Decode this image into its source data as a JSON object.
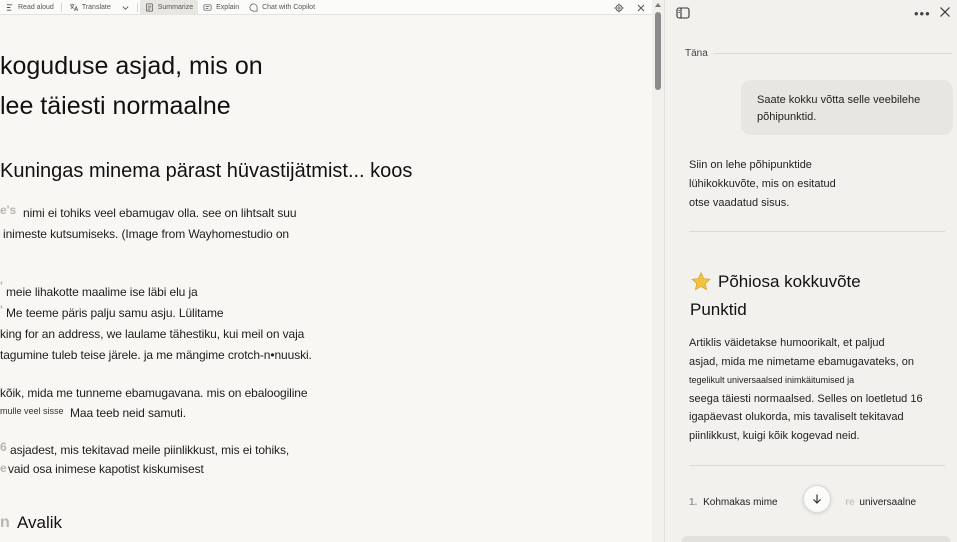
{
  "toolbar": {
    "read_aloud": "Read aloud",
    "translate": "Translate",
    "summarize": "Summarize",
    "explain": "Explain",
    "chat": "Chat with Copilot"
  },
  "article": {
    "heading1_line1": "koguduse asjad, mis on",
    "heading1_line2": "lee täiesti normaalne",
    "heading2": "Kuningas minema pärast hüvastijätmist... koos",
    "para1_frag": "e's",
    "para1_line1": "nimi ei tohiks veel ebamugav olla. see on lihtsalt suu",
    "para1_line2": "inimeste kutsumiseks. (Image from Wayhomestudio on",
    "para2_frag1": "'",
    "para2_line1": "meie lihakotte maalime ise läbi elu ja",
    "para2_frag2": "'",
    "para2_line2": "Me teeme päris palju samu asju. Lülitame",
    "para2_line3": "king for an address, we laulame tähestiku, kui meil on vaja",
    "para2_line4": "tagumine tuleb teise järele. ja me mängime crotch-n•nuuski.",
    "para3_line1": "kõik, mida me tunneme ebamugavana. mis on ebaloogiline",
    "para3_tiny": "mulle veel sisse",
    "para3_line2": "Maa teeb neid samuti.",
    "para4_frag1": "6",
    "para4_line1": "asjadest, mis tekitavad meile piinlikkust, mis ei tohiks,",
    "para4_frag2": "e",
    "para4_line2": "vaid osa inimese kapotist kiskumisest",
    "heading3_frag": "n",
    "heading3": "Avalik"
  },
  "copilot": {
    "date_label": "Täna",
    "user_message": "Saate kokku võtta selle veebilehe põhipunktid.",
    "reply_line1": "Siin on lehe põhipunktide",
    "reply_line2": "lühikokkuvõte, mis on esitatud",
    "reply_line3": "otse vaadatud sisus.",
    "summary_title_line1": "Põhiosa kokkuvõte",
    "summary_title_line2": "Punktid",
    "summary_l1": "Artiklis väidetakse humoorikalt, et paljud",
    "summary_l2": "asjad, mida me nimetame ebamugavateks, on",
    "summary_l3": "tegelikult universaalsed inimkäitumised ja",
    "summary_l4": "seega täiesti normaalsed. Selles on loetletud 16",
    "summary_l5": "igapäevast olukorda, mis tavaliselt tekitavad",
    "summary_l6": "piinlikkust, kuigi kõik kogevad neid.",
    "list_number": "1.",
    "list_text": "Kohmakas mime",
    "list_ghost": "re",
    "list_suffix": "universaalne"
  }
}
